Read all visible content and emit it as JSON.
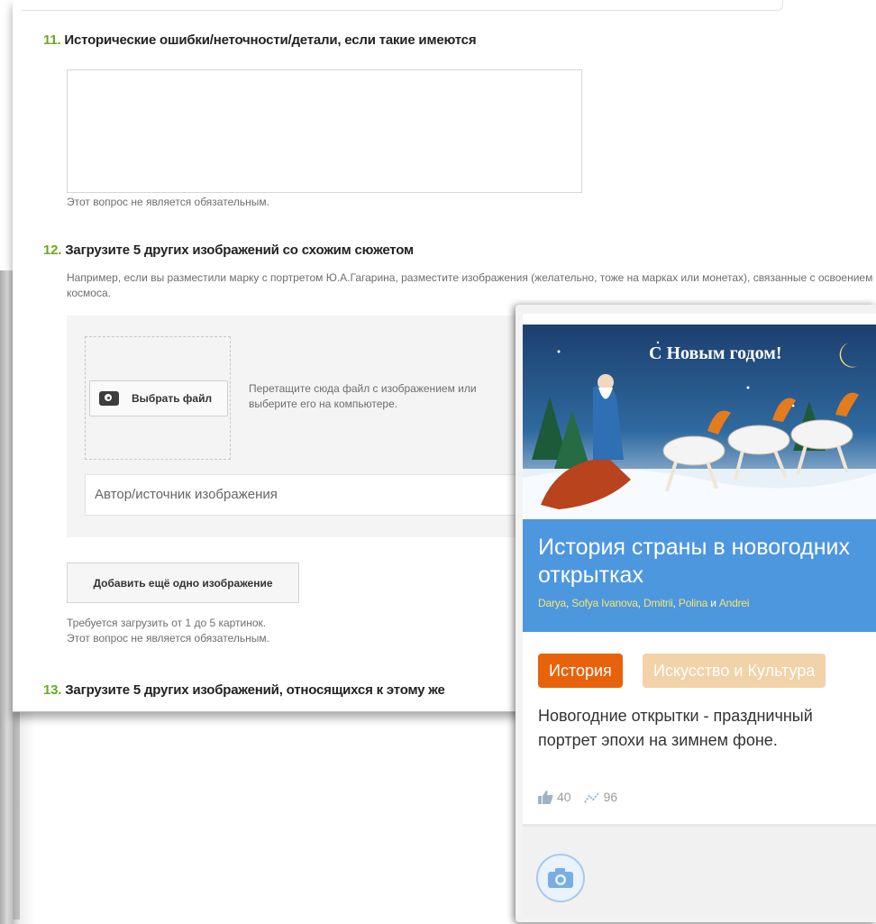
{
  "form": {
    "q11": {
      "number": "11.",
      "title": "Исторические ошибки/неточности/детали, если такие имеются",
      "optional_note": "Этот вопрос не является обязательным."
    },
    "q12": {
      "number": "12.",
      "title": "Загрузите 5 других изображений со схожим сюжетом",
      "hint": "Например, если вы разместили марку с портретом Ю.А.Гагарина, разместите изображения (желательно, тоже на марках или монетах), связанные с освоением космоса.",
      "pick_file_label": "Выбрать файл",
      "drop_text": "Перетащите сюда файл с изображением или выберите его на компьютере.",
      "source_placeholder": "Автор/источник изображения",
      "add_button_label": "Добавить ещё одно изображение",
      "requirement_note": "Требуется загрузить от 1 до 5 картинок.",
      "optional_note": "Этот вопрос не является обязательным."
    },
    "q13": {
      "number": "13.",
      "title": "Загрузите 5 других изображений, относящихся к этому же"
    }
  },
  "card": {
    "image_caption": "С Новым годом!",
    "title": "История страны в новогодних открытках",
    "authors": [
      "Darya",
      "Sofya Ivanova",
      "Dmitrii",
      "Polina",
      "Andrei"
    ],
    "authors_sep": ", ",
    "authors_and": "и",
    "tags": [
      "История",
      "Искусство и Культура"
    ],
    "description": "Новогодние открытки - праздничный портрет эпохи на зимнем фоне.",
    "likes": "40",
    "views": "96",
    "colors": {
      "banner": "#4d97df",
      "tag_history": "#e8620c",
      "tag_art": "#f2d2a8",
      "authors": "#f7e66a"
    }
  },
  "icons": {
    "camera": "camera-icon",
    "like": "thumbs-up-icon",
    "views": "trend-icon"
  },
  "colors": {
    "question_number": "#6ca820"
  }
}
